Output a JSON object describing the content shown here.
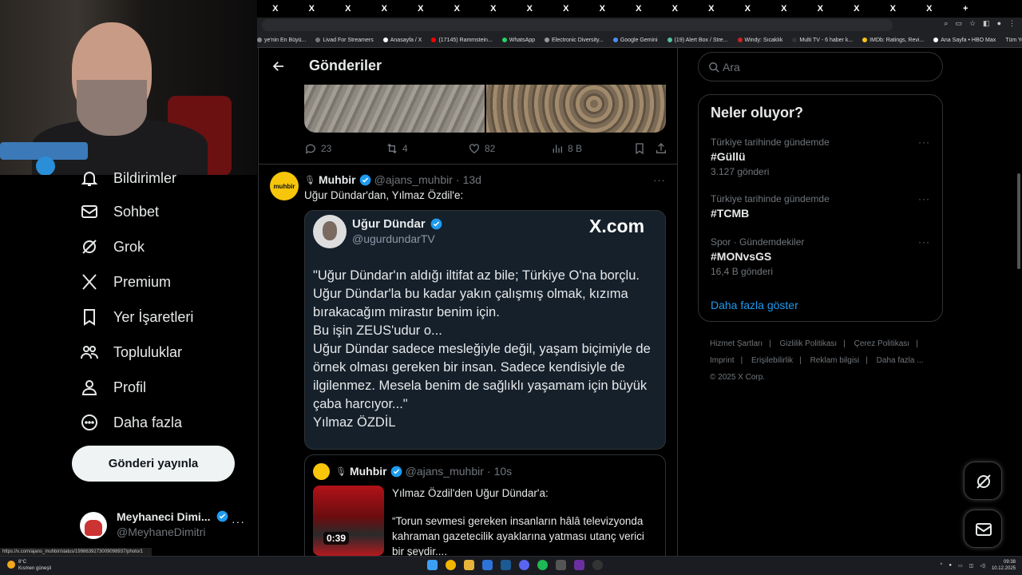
{
  "browser": {
    "tab_glyph": "X",
    "bookmarks": [
      {
        "label": "ye'nin En Büyü...",
        "color": "#888"
      },
      {
        "label": "Livad For Streamers",
        "color": "#777"
      },
      {
        "label": "Anasayfa / X",
        "color": "#fff"
      },
      {
        "label": "(17145) Rammstein...",
        "color": "#f00"
      },
      {
        "label": "WhatsApp",
        "color": "#25d366"
      },
      {
        "label": "Electronic Diversity...",
        "color": "#999"
      },
      {
        "label": "Google Gemini",
        "color": "#4d8ef7"
      },
      {
        "label": "(19) Alert Box / Stre...",
        "color": "#53c29a"
      },
      {
        "label": "Windy: Sıcaklık",
        "color": "#c22"
      },
      {
        "label": "Multi TV - 6 haber k...",
        "color": "#333"
      },
      {
        "label": "IMDb: Ratings, Revi...",
        "color": "#f5c518"
      },
      {
        "label": "Ana Sayfa • HBO Max",
        "color": "#fff"
      }
    ],
    "bookmarks_all": "Tüm Yer İşaretleri"
  },
  "sidebar": {
    "items": [
      {
        "label": "Bildirimler",
        "icon": "bell-icon"
      },
      {
        "label": "Sohbet",
        "icon": "mail-icon"
      },
      {
        "label": "Grok",
        "icon": "grok-icon"
      },
      {
        "label": "Premium",
        "icon": "x-logo-icon"
      },
      {
        "label": "Yer İşaretleri",
        "icon": "bookmark-icon"
      },
      {
        "label": "Topluluklar",
        "icon": "communities-icon"
      },
      {
        "label": "Profil",
        "icon": "person-icon"
      },
      {
        "label": "Daha fazla",
        "icon": "more-circle-icon"
      }
    ],
    "post_button": "Gönderi yayınla",
    "account": {
      "name": "Meyhaneci Dimi...",
      "handle": "@MeyhaneDimitri",
      "more": "···"
    }
  },
  "main": {
    "title": "Gönderiler",
    "prev_post_actions": {
      "replies": "23",
      "reposts": "4",
      "likes": "82",
      "views": "8 B"
    },
    "post": {
      "avatar_text": "muhbir",
      "author": "Muhbir",
      "handle": "@ajans_muhbir",
      "dot": "·",
      "time": "13d",
      "more": "···",
      "text": "Uğur Dündar'dan, Yılmaz Özdil'e:",
      "card": {
        "name": "Uğur Dündar",
        "handle": "@ugurdundarTV",
        "brand": "X.com",
        "quote": "\"Uğur Dündar'ın aldığı iltifat az bile; Türkiye O'na borçlu.\nUğur Dündar'la bu kadar yakın çalışmış olmak, kızıma bırakacağım mirastır benim için.\nBu işin ZEUS'udur o...\nUğur Dündar sadece mesleğiyle değil, yaşam biçimiyle de örnek olması gereken bir insan. Sadece kendisiyle de ilgilenmez. Mesela benim de sağlıklı yaşamam için büyük çaba harcıyor...\"\nYılmaz ÖZDİL"
      },
      "quoted": {
        "author": "Muhbir",
        "handle": "@ajans_muhbir",
        "dot": "·",
        "time": "10s",
        "title": "Yılmaz Özdil'den Uğur Dündar'a:",
        "text": "“Torun sevmesi gereken insanların hâlâ televizyonda kahraman gazetecilik ayaklarına yatması utanç verici bir şeydir....",
        "duration": "0:39"
      }
    }
  },
  "right": {
    "search_placeholder": "Ara",
    "trends_title": "Neler oluyor?",
    "trends": [
      {
        "context": "Türkiye tarihinde gündemde",
        "title": "#Güllü",
        "count": "3.127 gönderi"
      },
      {
        "context": "Türkiye tarihinde gündemde",
        "title": "#TCMB",
        "count": ""
      },
      {
        "context": "Spor · Gündemdekiler",
        "title": "#MONvsGS",
        "count": "16,4 B gönderi"
      }
    ],
    "show_more": "Daha fazla göster",
    "footer": [
      "Hizmet Şartları",
      "Gizlilik Politikası",
      "Çerez Politikası",
      "Imprint",
      "Erişilebilirlik",
      "Reklam bilgisi",
      "Daha fazla ...",
      "© 2025 X Corp."
    ]
  },
  "statusbar": {
    "url": "https://x.com/ajans_muhbir/status/1998639273009098937/photo/1"
  },
  "taskbar": {
    "temp": "8°C",
    "weather": "Kısmen güneşli",
    "time": "09:38",
    "date": "10.12.2025"
  },
  "colors": {
    "accent": "#1d9bf0",
    "verified": "#1d9bf0",
    "muted": "#71767b",
    "card_bg": "#15202b"
  }
}
